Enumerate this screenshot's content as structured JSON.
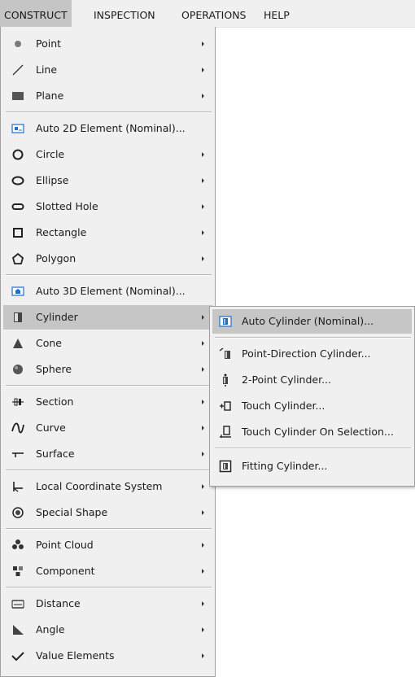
{
  "menubar": {
    "items": [
      "CONSTRUCT",
      "INSPECTION",
      "OPERATIONS",
      "HELP"
    ]
  },
  "menu": {
    "items": [
      {
        "label": "Point",
        "icon": "point-dot-icon",
        "has_submenu": true
      },
      {
        "label": "Line",
        "icon": "line-icon",
        "has_submenu": true
      },
      {
        "label": "Plane",
        "icon": "plane-icon",
        "has_submenu": true
      },
      {
        "label": "Auto 2D Element (Nominal)...",
        "icon": "auto-2d-element-icon",
        "has_submenu": false
      },
      {
        "label": "Circle",
        "icon": "circle-icon",
        "has_submenu": true
      },
      {
        "label": "Ellipse",
        "icon": "ellipse-icon",
        "has_submenu": true
      },
      {
        "label": "Slotted Hole",
        "icon": "slotted-hole-icon",
        "has_submenu": true
      },
      {
        "label": "Rectangle",
        "icon": "rectangle-icon",
        "has_submenu": true
      },
      {
        "label": "Polygon",
        "icon": "polygon-icon",
        "has_submenu": true
      },
      {
        "label": "Auto 3D Element (Nominal)...",
        "icon": "auto-3d-element-icon",
        "has_submenu": false
      },
      {
        "label": "Cylinder",
        "icon": "cylinder-icon",
        "has_submenu": true
      },
      {
        "label": "Cone",
        "icon": "cone-icon",
        "has_submenu": true
      },
      {
        "label": "Sphere",
        "icon": "sphere-icon",
        "has_submenu": true
      },
      {
        "label": "Section",
        "icon": "section-icon",
        "has_submenu": true
      },
      {
        "label": "Curve",
        "icon": "curve-icon",
        "has_submenu": true
      },
      {
        "label": "Surface",
        "icon": "surface-icon",
        "has_submenu": true
      },
      {
        "label": "Local Coordinate System",
        "icon": "coordinate-system-icon",
        "has_submenu": true
      },
      {
        "label": "Special Shape",
        "icon": "special-shape-icon",
        "has_submenu": true
      },
      {
        "label": "Point Cloud",
        "icon": "point-cloud-icon",
        "has_submenu": true
      },
      {
        "label": "Component",
        "icon": "component-icon",
        "has_submenu": true
      },
      {
        "label": "Distance",
        "icon": "distance-icon",
        "has_submenu": true
      },
      {
        "label": "Angle",
        "icon": "angle-icon",
        "has_submenu": true
      },
      {
        "label": "Value Elements",
        "icon": "value-elements-icon",
        "has_submenu": true
      }
    ]
  },
  "submenu": {
    "items": [
      {
        "label": "Auto Cylinder (Nominal)...",
        "icon": "auto-cylinder-icon"
      },
      {
        "label": "Point-Direction Cylinder...",
        "icon": "point-direction-cylinder-icon"
      },
      {
        "label": "2-Point Cylinder...",
        "icon": "two-point-cylinder-icon"
      },
      {
        "label": "Touch Cylinder...",
        "icon": "touch-cylinder-icon"
      },
      {
        "label": "Touch Cylinder On Selection...",
        "icon": "touch-cylinder-selection-icon"
      },
      {
        "label": "Fitting Cylinder...",
        "icon": "fitting-cylinder-icon"
      }
    ]
  },
  "colors": {
    "menu_background": "#f0f0f0",
    "highlight": "#c6c6c6",
    "icon_blue": "#1f6fc8"
  }
}
